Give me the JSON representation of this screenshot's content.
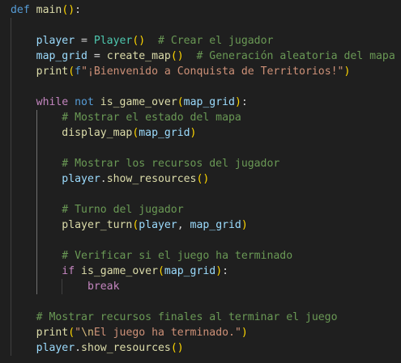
{
  "theme": {
    "background": "#1f1f1f",
    "keyword": "#569cd6",
    "control": "#c586c0",
    "function": "#dcdcaa",
    "class": "#4ec9b0",
    "variable": "#9cdcfe",
    "string": "#ce9178",
    "escape": "#d7ba7d",
    "comment": "#6a9955",
    "default": "#d4d4d4",
    "bracket1": "#ffd700",
    "bracket2": "#da70d6",
    "bracket3": "#179fff"
  },
  "code": {
    "lines": [
      [
        {
          "t": "def",
          "c": "keyword"
        },
        {
          "t": " "
        },
        {
          "t": "main",
          "c": "function"
        },
        {
          "t": "(",
          "c": "bracket1"
        },
        {
          "t": ")",
          "c": "bracket1"
        },
        {
          "t": ":"
        }
      ],
      [],
      [
        {
          "t": "    "
        },
        {
          "t": "player",
          "c": "variable"
        },
        {
          "t": " = "
        },
        {
          "t": "Player",
          "c": "class"
        },
        {
          "t": "(",
          "c": "bracket1"
        },
        {
          "t": ")",
          "c": "bracket1"
        },
        {
          "t": "  "
        },
        {
          "t": "# Crear el jugador",
          "c": "comment"
        }
      ],
      [
        {
          "t": "    "
        },
        {
          "t": "map_grid",
          "c": "variable"
        },
        {
          "t": " = "
        },
        {
          "t": "create_map",
          "c": "function"
        },
        {
          "t": "(",
          "c": "bracket1"
        },
        {
          "t": ")",
          "c": "bracket1"
        },
        {
          "t": "  "
        },
        {
          "t": "# Generación aleatoria del mapa",
          "c": "comment"
        }
      ],
      [
        {
          "t": "    "
        },
        {
          "t": "print",
          "c": "function"
        },
        {
          "t": "(",
          "c": "bracket1"
        },
        {
          "t": "f",
          "c": "keyword"
        },
        {
          "t": "\"¡Bienvenido a Conquista de Territorios!\"",
          "c": "string"
        },
        {
          "t": ")",
          "c": "bracket1"
        }
      ],
      [],
      [
        {
          "t": "    "
        },
        {
          "t": "while",
          "c": "control"
        },
        {
          "t": " "
        },
        {
          "t": "not",
          "c": "keyword"
        },
        {
          "t": " "
        },
        {
          "t": "is_game_over",
          "c": "function"
        },
        {
          "t": "(",
          "c": "bracket1"
        },
        {
          "t": "map_grid",
          "c": "variable"
        },
        {
          "t": ")",
          "c": "bracket1"
        },
        {
          "t": ":"
        }
      ],
      [
        {
          "t": "        "
        },
        {
          "t": "# Mostrar el estado del mapa",
          "c": "comment"
        }
      ],
      [
        {
          "t": "        "
        },
        {
          "t": "display_map",
          "c": "function"
        },
        {
          "t": "(",
          "c": "bracket1"
        },
        {
          "t": "map_grid",
          "c": "variable"
        },
        {
          "t": ")",
          "c": "bracket1"
        }
      ],
      [],
      [
        {
          "t": "        "
        },
        {
          "t": "# Mostrar los recursos del jugador",
          "c": "comment"
        }
      ],
      [
        {
          "t": "        "
        },
        {
          "t": "player",
          "c": "variable"
        },
        {
          "t": "."
        },
        {
          "t": "show_resources",
          "c": "function"
        },
        {
          "t": "(",
          "c": "bracket1"
        },
        {
          "t": ")",
          "c": "bracket1"
        }
      ],
      [],
      [
        {
          "t": "        "
        },
        {
          "t": "# Turno del jugador",
          "c": "comment"
        }
      ],
      [
        {
          "t": "        "
        },
        {
          "t": "player_turn",
          "c": "function"
        },
        {
          "t": "(",
          "c": "bracket1"
        },
        {
          "t": "player",
          "c": "variable"
        },
        {
          "t": ", "
        },
        {
          "t": "map_grid",
          "c": "variable"
        },
        {
          "t": ")",
          "c": "bracket1"
        }
      ],
      [],
      [
        {
          "t": "        "
        },
        {
          "t": "# Verificar si el juego ha terminado",
          "c": "comment"
        }
      ],
      [
        {
          "t": "        "
        },
        {
          "t": "if",
          "c": "control"
        },
        {
          "t": " "
        },
        {
          "t": "is_game_over",
          "c": "function"
        },
        {
          "t": "(",
          "c": "bracket1"
        },
        {
          "t": "map_grid",
          "c": "variable"
        },
        {
          "t": ")",
          "c": "bracket1"
        },
        {
          "t": ":"
        }
      ],
      [
        {
          "t": "            "
        },
        {
          "t": "break",
          "c": "control"
        }
      ],
      [],
      [
        {
          "t": "    "
        },
        {
          "t": "# Mostrar recursos finales al terminar el juego",
          "c": "comment"
        }
      ],
      [
        {
          "t": "    "
        },
        {
          "t": "print",
          "c": "function"
        },
        {
          "t": "(",
          "c": "bracket1"
        },
        {
          "t": "\"",
          "c": "string"
        },
        {
          "t": "\\n",
          "c": "escape"
        },
        {
          "t": "El juego ha terminado.\"",
          "c": "string"
        },
        {
          "t": ")",
          "c": "bracket1"
        }
      ],
      [
        {
          "t": "    "
        },
        {
          "t": "player",
          "c": "variable"
        },
        {
          "t": "."
        },
        {
          "t": "show_resources",
          "c": "function"
        },
        {
          "t": "(",
          "c": "bracket1"
        },
        {
          "t": ")",
          "c": "bracket1"
        }
      ]
    ]
  }
}
